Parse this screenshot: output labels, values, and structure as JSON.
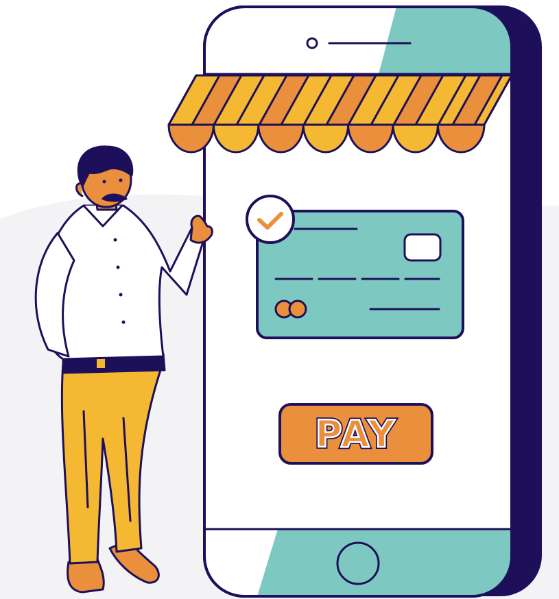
{
  "pay_button": {
    "label": "PAY"
  },
  "palette": {
    "outline": "#1d0f5a",
    "teal": "#7dc9c1",
    "orange": "#ea8f3c",
    "yellow": "#f5b833",
    "skin": "#e98f3d",
    "white": "#ffffff",
    "background_blob": "#f3f3f5"
  },
  "icons": [
    "check-icon",
    "card-chip-icon",
    "mastercard-logo-icon",
    "home-button-icon",
    "speaker-icon"
  ]
}
